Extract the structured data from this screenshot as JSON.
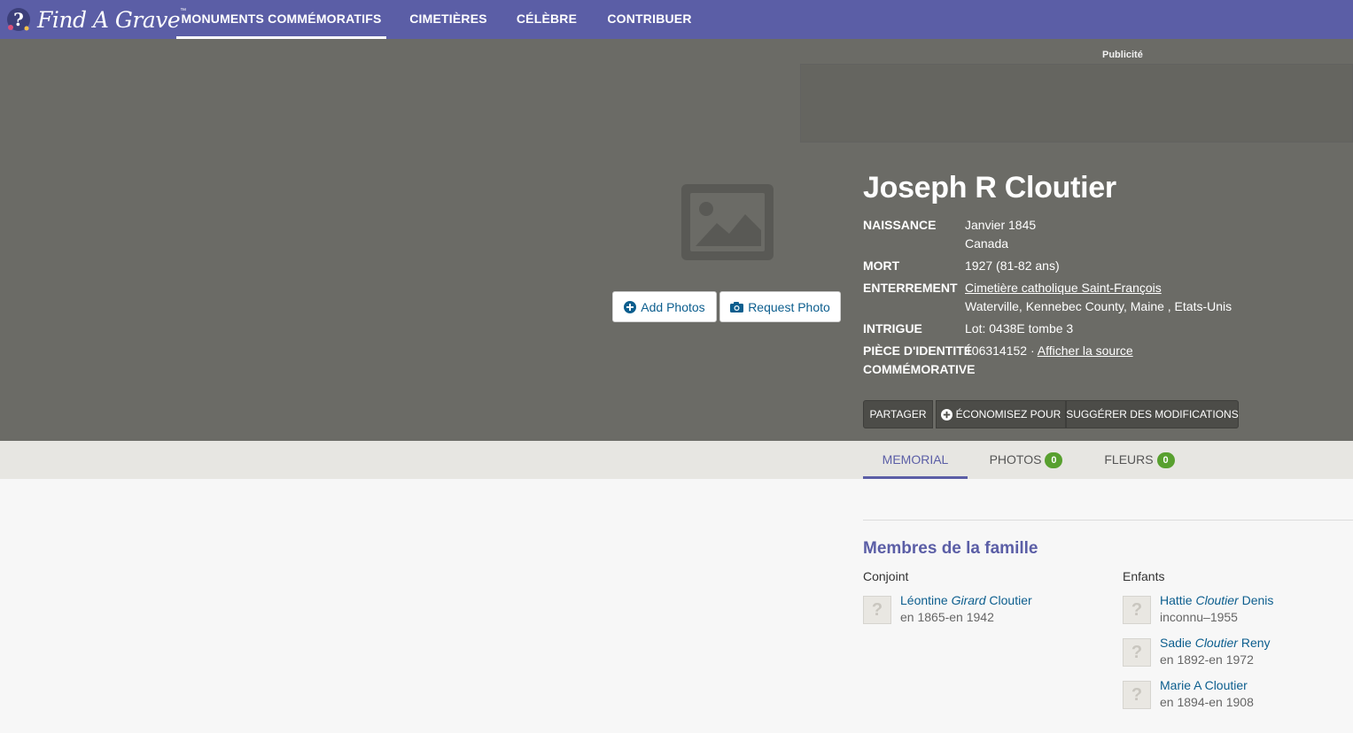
{
  "nav": {
    "logo_text": "Find A Grave",
    "logo_tm": "™",
    "items": [
      {
        "label": "MONUMENTS COMMÉMORATIFS",
        "active": true
      },
      {
        "label": "CIMETIÈRES"
      },
      {
        "label": "CÉLÈBRE"
      },
      {
        "label": "CONTRIBUER"
      }
    ]
  },
  "ad": {
    "label": "Publicité"
  },
  "photo": {
    "placeholder_icon": "image-placeholder-icon",
    "add_label": "Add Photos",
    "request_label": "Request Photo"
  },
  "memorial": {
    "name": "Joseph R Cloutier",
    "birth_label": "NAISSANCE",
    "birth_date": "Janvier 1845",
    "birth_place": "Canada",
    "death_label": "MORT",
    "death_value": "1927 (81-82 ans)",
    "burial_label": "ENTERREMENT",
    "burial_cemetery": "Cimetière catholique Saint-François",
    "burial_location": "Waterville, Kennebec County, Maine , Etats-Unis",
    "plot_label": "INTRIGUE",
    "plot_value": "Lot: 0438E tombe 3",
    "id_label_1": "PIÈCE D'IDENTITÉ",
    "id_label_2": "COMMÉMORATIVE",
    "id_value": "106314152 ·",
    "id_source": "Afficher la source"
  },
  "actions": {
    "share": "PARTAGER",
    "save": "ÉCONOMISEZ POUR",
    "suggest": "SUGGÉRER DES MODIFICATIONS"
  },
  "tabs": {
    "memorial": "MEMORIAL",
    "photos": "PHOTOS",
    "photos_count": "0",
    "flowers": "FLEURS",
    "flowers_count": "0"
  },
  "family": {
    "title": "Membres de la famille",
    "spouse_heading": "Conjoint",
    "children_heading": "Enfants",
    "spouse": {
      "first": "Léontine",
      "maiden": "Girard",
      "last": "Cloutier",
      "dates": "en 1865-en 1942"
    },
    "children": [
      {
        "first": "Hattie",
        "maiden": "Cloutier",
        "last": "Denis",
        "dates": "inconnu–1955"
      },
      {
        "first": "Sadie",
        "maiden": "Cloutier",
        "last": "Reny",
        "dates": "en 1892-en 1972"
      },
      {
        "first": "Marie A Cloutier",
        "maiden": "",
        "last": "",
        "dates": "en 1894-en 1908"
      }
    ]
  },
  "colors": {
    "brand": "#5b5ea6",
    "hero": "#6b6b66",
    "link": "#0c5e8e",
    "badge": "#58a02f"
  }
}
